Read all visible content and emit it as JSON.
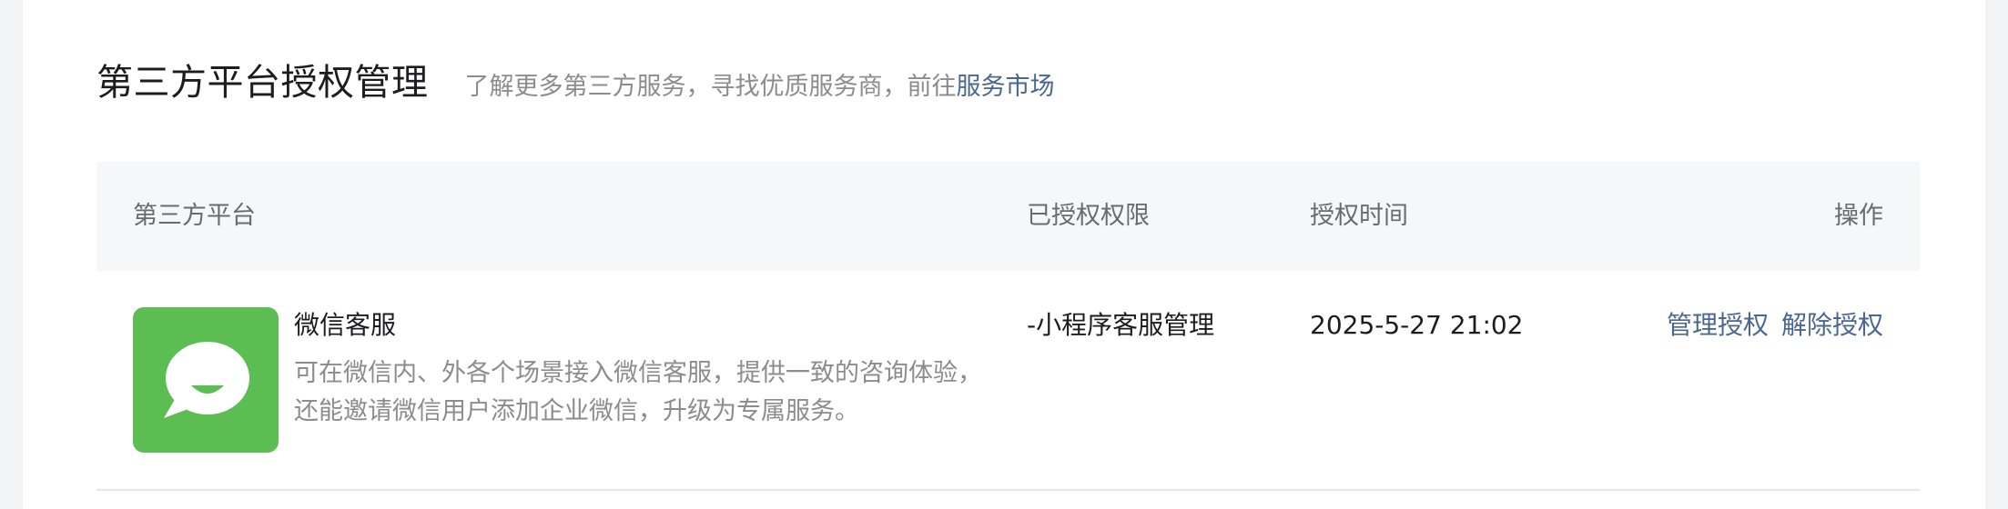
{
  "header": {
    "title": "第三方平台授权管理",
    "subtitle": "了解更多第三方服务，寻找优质服务商，前往",
    "market_link": "服务市场"
  },
  "table": {
    "columns": {
      "platform": "第三方平台",
      "permissions": "已授权权限",
      "time": "授权时间",
      "actions": "操作"
    },
    "rows": [
      {
        "icon": "wechat-customer-service-icon",
        "icon_color": "#5cbd52",
        "name": "微信客服",
        "description": "可在微信内、外各个场景接入微信客服，提供一致的咨询体验，还能邀请微信用户添加企业微信，升级为专属服务。",
        "permissions": "-小程序客服管理",
        "time": "2025-5-27 21:02",
        "manage_label": "管理授权",
        "revoke_label": "解除授权"
      }
    ]
  },
  "colors": {
    "link": "#4a6791",
    "header_bg": "#f6f7f9",
    "text": "#1d1d1f",
    "muted": "#8c8c8c"
  }
}
